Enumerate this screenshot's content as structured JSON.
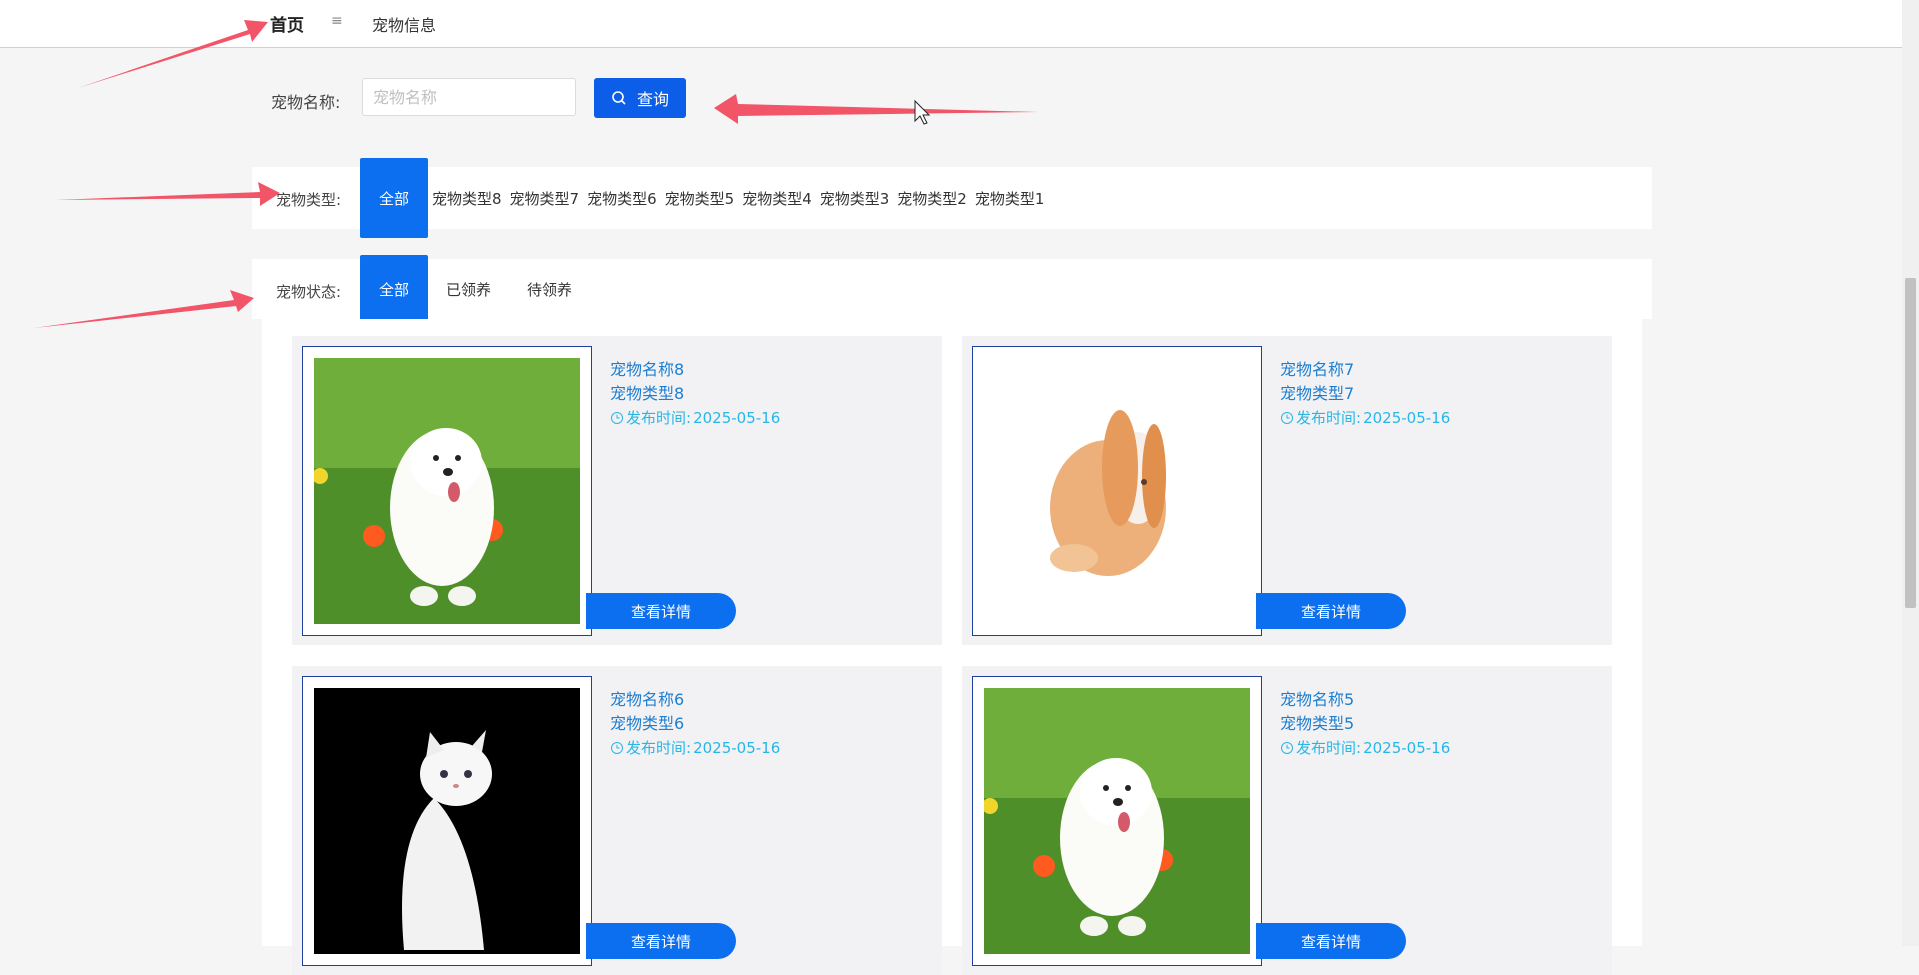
{
  "breadcrumb": {
    "home": "首页",
    "separator": "≡",
    "current": "宠物信息"
  },
  "search": {
    "label": "宠物名称:",
    "placeholder": "宠物名称",
    "value": "",
    "button_label": "查询"
  },
  "type_filter": {
    "label": "宠物类型:",
    "options": [
      "全部",
      "宠物类型8",
      "宠物类型7",
      "宠物类型6",
      "宠物类型5",
      "宠物类型4",
      "宠物类型3",
      "宠物类型2",
      "宠物类型1"
    ],
    "selected": "全部"
  },
  "status_filter": {
    "label": "宠物状态:",
    "options": [
      "全部",
      "已领养",
      "待领养"
    ],
    "selected": "全部"
  },
  "cards": [
    {
      "name": "宠物名称8",
      "type": "宠物类型8",
      "date_label": "发布时间:",
      "date": "2025-05-16",
      "button": "查看详情",
      "image": "white-puppy"
    },
    {
      "name": "宠物名称7",
      "type": "宠物类型7",
      "date_label": "发布时间:",
      "date": "2025-05-16",
      "button": "查看详情",
      "image": "orange-rabbit"
    },
    {
      "name": "宠物名称6",
      "type": "宠物类型6",
      "date_label": "发布时间:",
      "date": "2025-05-16",
      "button": "查看详情",
      "image": "white-cat"
    },
    {
      "name": "宠物名称5",
      "type": "宠物类型5",
      "date_label": "发布时间:",
      "date": "2025-05-16",
      "button": "查看详情",
      "image": "white-puppy"
    }
  ],
  "colors": {
    "primary": "#0c6ff0",
    "link": "#1e7ecf",
    "date": "#26b7e8",
    "annotation_arrow": "#f25468"
  }
}
